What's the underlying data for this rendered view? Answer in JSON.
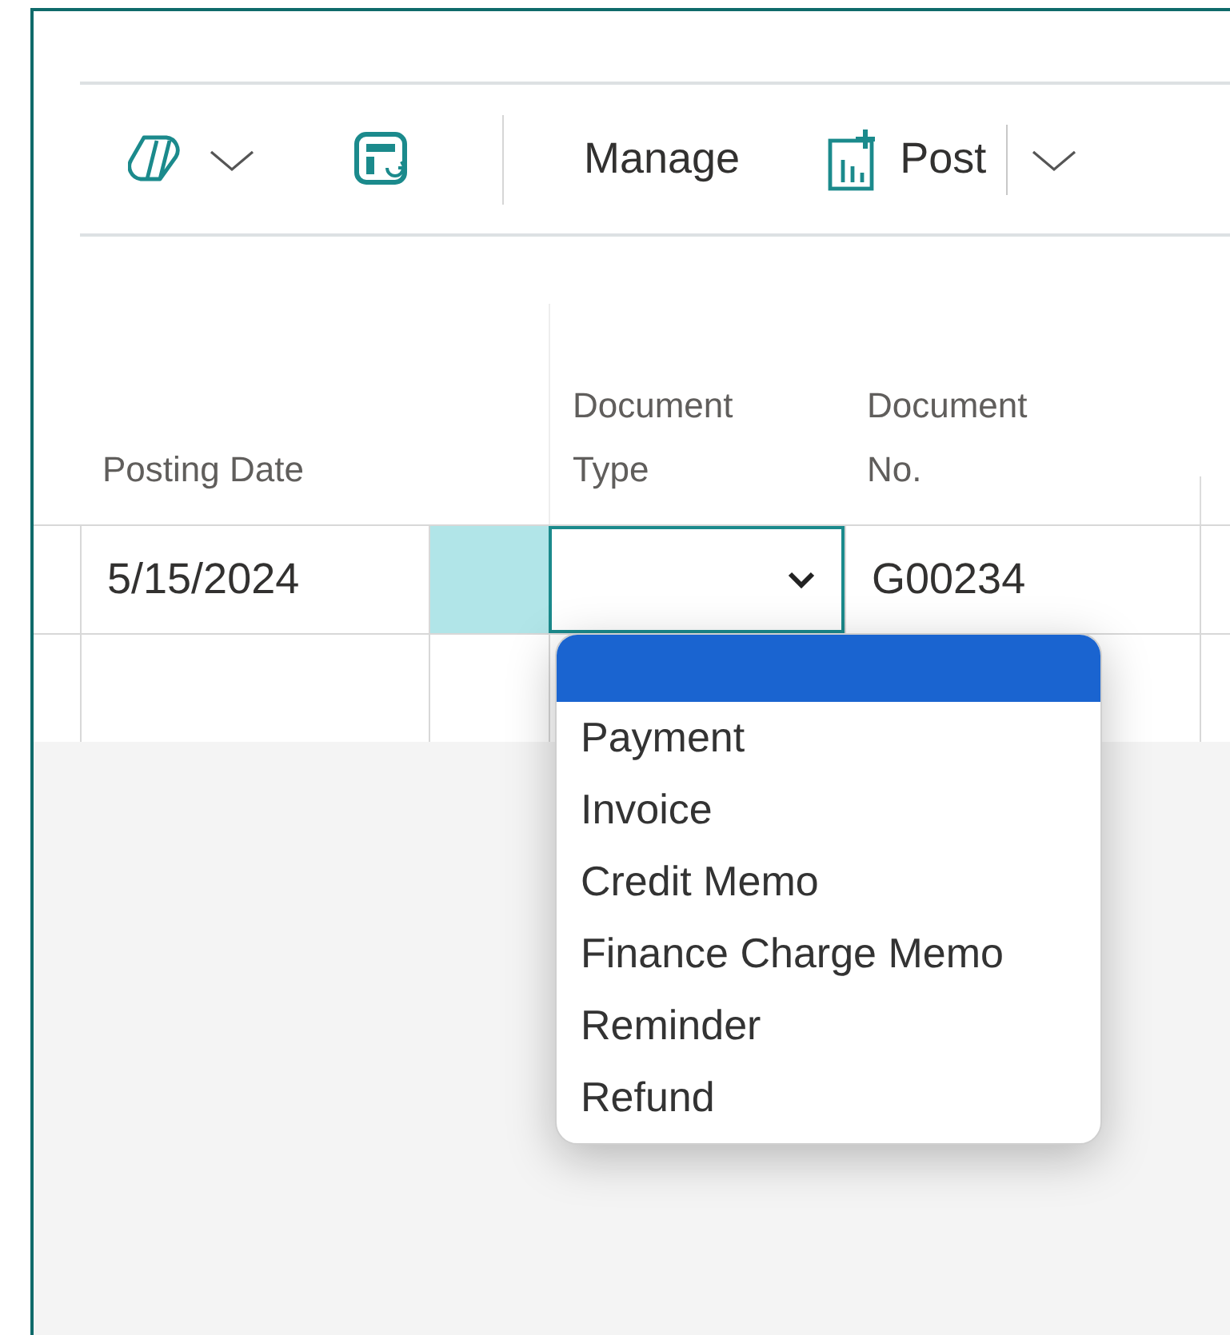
{
  "toolbar": [
    {
      "kind": "copilot"
    },
    {
      "kind": "layout"
    },
    {
      "kind": "text",
      "label": "Manage"
    },
    {
      "kind": "post",
      "label": "Post"
    }
  ],
  "table": {
    "columns": [
      {
        "label": "Posting Date"
      },
      {},
      {
        "label": "Document Type"
      },
      {
        "label": "Document No."
      }
    ],
    "rows": [
      {
        "selected": true,
        "cells": [
          {
            "text": "5/15/2024"
          },
          {},
          {},
          {
            "text": "G00234"
          }
        ]
      },
      {
        "selected": false,
        "cells": [
          {},
          {},
          {},
          {}
        ]
      }
    ]
  },
  "dropdown": {
    "options": [
      {
        "selected": true
      },
      {
        "label": "Payment",
        "selected": false
      },
      {
        "label": "Invoice",
        "selected": false
      },
      {
        "label": "Credit Memo",
        "selected": false
      },
      {
        "label": "Finance Charge Memo",
        "selected": false
      },
      {
        "label": "Reminder",
        "selected": false
      },
      {
        "label": "Refund",
        "selected": false
      }
    ]
  }
}
